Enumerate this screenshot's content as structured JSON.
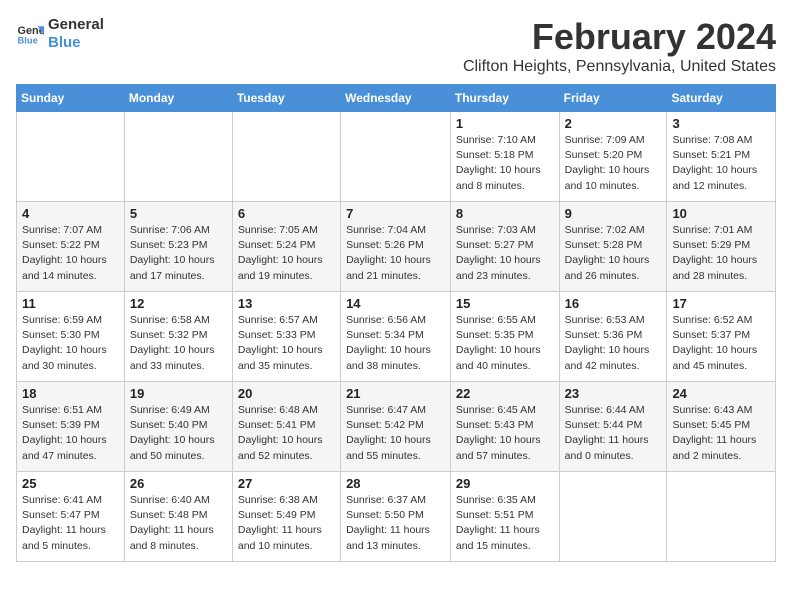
{
  "logo": {
    "line1": "General",
    "line2": "Blue"
  },
  "title": "February 2024",
  "location": "Clifton Heights, Pennsylvania, United States",
  "days_of_week": [
    "Sunday",
    "Monday",
    "Tuesday",
    "Wednesday",
    "Thursday",
    "Friday",
    "Saturday"
  ],
  "weeks": [
    [
      {
        "day": "",
        "detail": ""
      },
      {
        "day": "",
        "detail": ""
      },
      {
        "day": "",
        "detail": ""
      },
      {
        "day": "",
        "detail": ""
      },
      {
        "day": "1",
        "detail": "Sunrise: 7:10 AM\nSunset: 5:18 PM\nDaylight: 10 hours\nand 8 minutes."
      },
      {
        "day": "2",
        "detail": "Sunrise: 7:09 AM\nSunset: 5:20 PM\nDaylight: 10 hours\nand 10 minutes."
      },
      {
        "day": "3",
        "detail": "Sunrise: 7:08 AM\nSunset: 5:21 PM\nDaylight: 10 hours\nand 12 minutes."
      }
    ],
    [
      {
        "day": "4",
        "detail": "Sunrise: 7:07 AM\nSunset: 5:22 PM\nDaylight: 10 hours\nand 14 minutes."
      },
      {
        "day": "5",
        "detail": "Sunrise: 7:06 AM\nSunset: 5:23 PM\nDaylight: 10 hours\nand 17 minutes."
      },
      {
        "day": "6",
        "detail": "Sunrise: 7:05 AM\nSunset: 5:24 PM\nDaylight: 10 hours\nand 19 minutes."
      },
      {
        "day": "7",
        "detail": "Sunrise: 7:04 AM\nSunset: 5:26 PM\nDaylight: 10 hours\nand 21 minutes."
      },
      {
        "day": "8",
        "detail": "Sunrise: 7:03 AM\nSunset: 5:27 PM\nDaylight: 10 hours\nand 23 minutes."
      },
      {
        "day": "9",
        "detail": "Sunrise: 7:02 AM\nSunset: 5:28 PM\nDaylight: 10 hours\nand 26 minutes."
      },
      {
        "day": "10",
        "detail": "Sunrise: 7:01 AM\nSunset: 5:29 PM\nDaylight: 10 hours\nand 28 minutes."
      }
    ],
    [
      {
        "day": "11",
        "detail": "Sunrise: 6:59 AM\nSunset: 5:30 PM\nDaylight: 10 hours\nand 30 minutes."
      },
      {
        "day": "12",
        "detail": "Sunrise: 6:58 AM\nSunset: 5:32 PM\nDaylight: 10 hours\nand 33 minutes."
      },
      {
        "day": "13",
        "detail": "Sunrise: 6:57 AM\nSunset: 5:33 PM\nDaylight: 10 hours\nand 35 minutes."
      },
      {
        "day": "14",
        "detail": "Sunrise: 6:56 AM\nSunset: 5:34 PM\nDaylight: 10 hours\nand 38 minutes."
      },
      {
        "day": "15",
        "detail": "Sunrise: 6:55 AM\nSunset: 5:35 PM\nDaylight: 10 hours\nand 40 minutes."
      },
      {
        "day": "16",
        "detail": "Sunrise: 6:53 AM\nSunset: 5:36 PM\nDaylight: 10 hours\nand 42 minutes."
      },
      {
        "day": "17",
        "detail": "Sunrise: 6:52 AM\nSunset: 5:37 PM\nDaylight: 10 hours\nand 45 minutes."
      }
    ],
    [
      {
        "day": "18",
        "detail": "Sunrise: 6:51 AM\nSunset: 5:39 PM\nDaylight: 10 hours\nand 47 minutes."
      },
      {
        "day": "19",
        "detail": "Sunrise: 6:49 AM\nSunset: 5:40 PM\nDaylight: 10 hours\nand 50 minutes."
      },
      {
        "day": "20",
        "detail": "Sunrise: 6:48 AM\nSunset: 5:41 PM\nDaylight: 10 hours\nand 52 minutes."
      },
      {
        "day": "21",
        "detail": "Sunrise: 6:47 AM\nSunset: 5:42 PM\nDaylight: 10 hours\nand 55 minutes."
      },
      {
        "day": "22",
        "detail": "Sunrise: 6:45 AM\nSunset: 5:43 PM\nDaylight: 10 hours\nand 57 minutes."
      },
      {
        "day": "23",
        "detail": "Sunrise: 6:44 AM\nSunset: 5:44 PM\nDaylight: 11 hours\nand 0 minutes."
      },
      {
        "day": "24",
        "detail": "Sunrise: 6:43 AM\nSunset: 5:45 PM\nDaylight: 11 hours\nand 2 minutes."
      }
    ],
    [
      {
        "day": "25",
        "detail": "Sunrise: 6:41 AM\nSunset: 5:47 PM\nDaylight: 11 hours\nand 5 minutes."
      },
      {
        "day": "26",
        "detail": "Sunrise: 6:40 AM\nSunset: 5:48 PM\nDaylight: 11 hours\nand 8 minutes."
      },
      {
        "day": "27",
        "detail": "Sunrise: 6:38 AM\nSunset: 5:49 PM\nDaylight: 11 hours\nand 10 minutes."
      },
      {
        "day": "28",
        "detail": "Sunrise: 6:37 AM\nSunset: 5:50 PM\nDaylight: 11 hours\nand 13 minutes."
      },
      {
        "day": "29",
        "detail": "Sunrise: 6:35 AM\nSunset: 5:51 PM\nDaylight: 11 hours\nand 15 minutes."
      },
      {
        "day": "",
        "detail": ""
      },
      {
        "day": "",
        "detail": ""
      }
    ]
  ]
}
